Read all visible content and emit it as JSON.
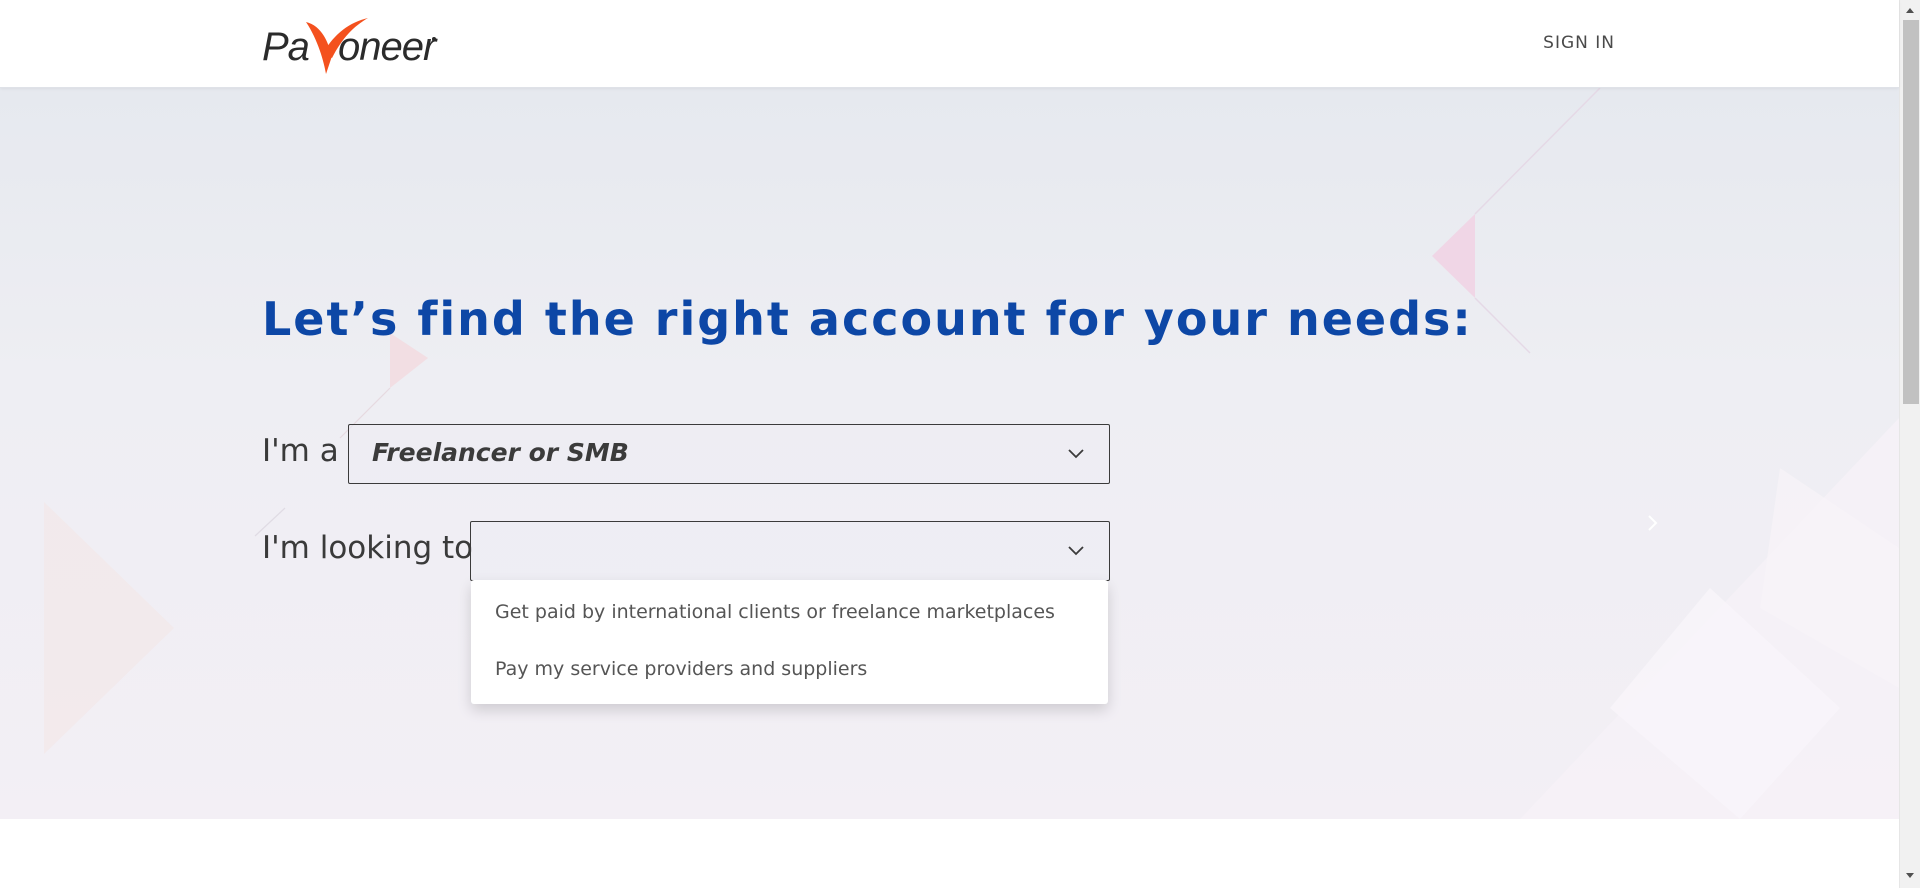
{
  "header": {
    "logo_text": "Payoneer",
    "sign_in_label": "SIGN IN"
  },
  "hero": {
    "title": "Let’s find the right account for your needs:",
    "row1": {
      "label": "I'm a",
      "selected_value": "Freelancer or SMB"
    },
    "row2": {
      "label": "I'm looking to",
      "selected_value": "",
      "options": [
        "Get paid by international clients or freelance marketplaces",
        "Pay my service providers and suppliers"
      ]
    }
  },
  "colors": {
    "title": "#0d47a6",
    "logo_orange": "#f4511e",
    "logo_text": "#2b2b2b"
  },
  "icons": [
    "chevron-down-icon",
    "chevron-right-icon",
    "scroll-up-arrow-icon",
    "scroll-down-arrow-icon"
  ]
}
